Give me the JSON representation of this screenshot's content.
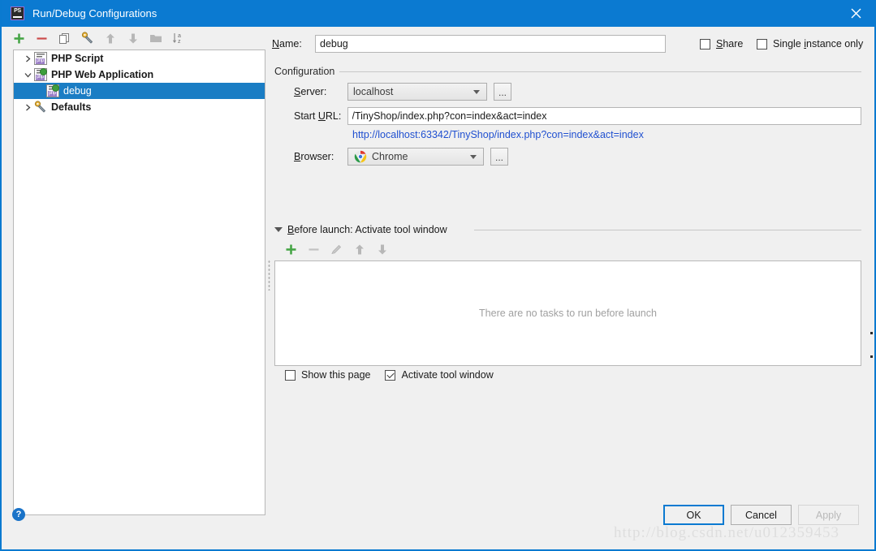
{
  "window": {
    "title": "Run/Debug Configurations",
    "app_icon": "php-storm-icon",
    "close_icon": "close-icon"
  },
  "tree_toolbar": {
    "items": [
      {
        "name": "add-configuration-button",
        "icon": "plus-icon",
        "label": "+"
      },
      {
        "name": "remove-configuration-button",
        "icon": "minus-icon",
        "label": "−"
      },
      {
        "name": "copy-configuration-button",
        "icon": "copy-icon",
        "label": ""
      },
      {
        "name": "edit-defaults-button",
        "icon": "wrench-icon",
        "label": ""
      },
      {
        "name": "move-up-button",
        "icon": "arrow-up-icon",
        "label": ""
      },
      {
        "name": "move-down-button",
        "icon": "arrow-down-icon",
        "label": ""
      },
      {
        "name": "create-folder-button",
        "icon": "folder-icon",
        "label": ""
      },
      {
        "name": "sort-configurations-button",
        "icon": "sort-az-icon",
        "label": ""
      }
    ]
  },
  "tree": {
    "nodes": [
      {
        "label": "PHP Script",
        "icon": "php-script-icon",
        "expanded": false,
        "selected": false,
        "level": 0,
        "bold": true
      },
      {
        "label": "PHP Web Application",
        "icon": "php-web-app-icon",
        "expanded": true,
        "selected": false,
        "level": 0,
        "bold": true
      },
      {
        "label": "debug",
        "icon": "php-web-app-icon",
        "expanded": null,
        "selected": true,
        "level": 1,
        "bold": false
      },
      {
        "label": "Defaults",
        "icon": "wrench-icon",
        "expanded": false,
        "selected": false,
        "level": 0,
        "bold": true
      }
    ]
  },
  "name_row": {
    "label": "Name:",
    "label_mnemonic": "N",
    "value": "debug",
    "placeholder": ""
  },
  "options": {
    "share": {
      "label": "Share",
      "mnemonic": "S",
      "checked": false
    },
    "single_instance": {
      "label": "Single instance only",
      "mnemonic": "i",
      "checked": false
    }
  },
  "configuration": {
    "group_title": "Configuration",
    "server": {
      "label": "Server:",
      "mnemonic": "S",
      "value": "localhost",
      "browse_label": "..."
    },
    "start_url": {
      "label": "Start URL:",
      "mnemonic": "U",
      "value": "/TinyShop/index.php?con=index&act=index"
    },
    "resolved_url": "http://localhost:63342/TinyShop/index.php?con=index&act=index",
    "browser": {
      "label": "Browser:",
      "mnemonic": "B",
      "value": "Chrome",
      "icon": "chrome-icon",
      "browse_label": "..."
    }
  },
  "before_launch": {
    "title": "Before launch: Activate tool window",
    "expanded": true,
    "toolbar": [
      {
        "name": "add-task-button",
        "icon": "plus-icon",
        "enabled": true
      },
      {
        "name": "remove-task-button",
        "icon": "minus-icon",
        "enabled": false
      },
      {
        "name": "edit-task-button",
        "icon": "pencil-icon",
        "enabled": false
      },
      {
        "name": "move-task-up-button",
        "icon": "arrow-up-icon",
        "enabled": true
      },
      {
        "name": "move-task-down-button",
        "icon": "arrow-down-icon",
        "enabled": true
      }
    ],
    "empty_text": "There are no tasks to run before launch",
    "show_this_page": {
      "label": "Show this page",
      "checked": false
    },
    "activate_tool_window": {
      "label": "Activate tool window",
      "checked": true
    }
  },
  "footer": {
    "help_label": "?",
    "watermark": "http://blog.csdn.net/u012359453",
    "buttons": [
      {
        "name": "ok-button",
        "label": "OK",
        "style": "primary",
        "enabled": true
      },
      {
        "name": "cancel-button",
        "label": "Cancel",
        "style": "normal",
        "enabled": true
      },
      {
        "name": "apply-button",
        "label": "Apply",
        "style": "disabled",
        "enabled": false
      }
    ]
  },
  "colors": {
    "titlebar": "#0b7ad1",
    "selection": "#1a7dc4",
    "link": "#2050d0",
    "accent": "#0b7ad1",
    "panel": "#f0f0f0"
  }
}
